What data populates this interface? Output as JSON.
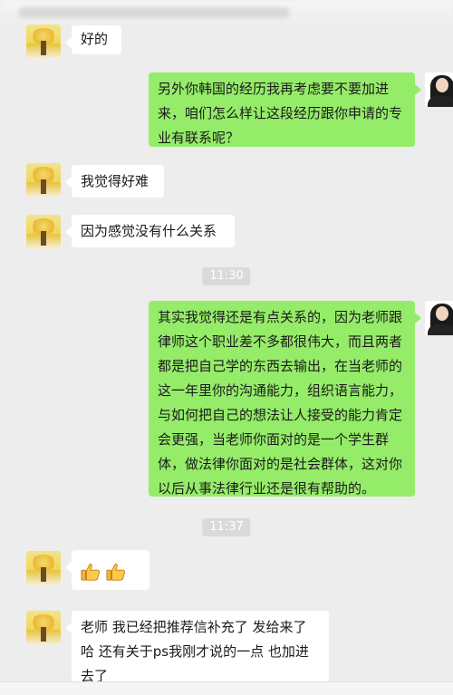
{
  "messages": [
    {
      "side": "in",
      "text": "好的"
    },
    {
      "side": "out",
      "text": "另外你韩国的经历我再考虑要不要加进来，咱们怎么样让这段经历跟你申请的专业有联系呢？"
    },
    {
      "side": "in",
      "text": "我觉得好难"
    },
    {
      "side": "in",
      "text": "因为感觉没有什么关系"
    },
    {
      "side": "time",
      "text": "11:30"
    },
    {
      "side": "out",
      "text": "其实我觉得还是有点关系的，因为老师跟律师这个职业差不多都很伟大，而且两者都是把自己学的东西去输出，在当老师的这一年里你的沟通能力，组织语言能力，与如何把自己的想法让人接受的能力肯定会更强，当老师你面对的是一个学生群体，做法律你面对的是社会群体，这对你以后从事法律行业还是很有帮助的。"
    },
    {
      "side": "time",
      "text": "11:37"
    },
    {
      "side": "in",
      "emoji": [
        "thumbs-up",
        "thumbs-up"
      ]
    },
    {
      "side": "in",
      "text": "老师 我已经把推荐信补充了 发给来了哈 还有关于ps我刚才说的一点 也加进去了"
    }
  ],
  "colors": {
    "background": "#ededed",
    "incoming_bubble": "#ffffff",
    "outgoing_bubble": "#95ec69",
    "time_badge": "#dadada"
  }
}
